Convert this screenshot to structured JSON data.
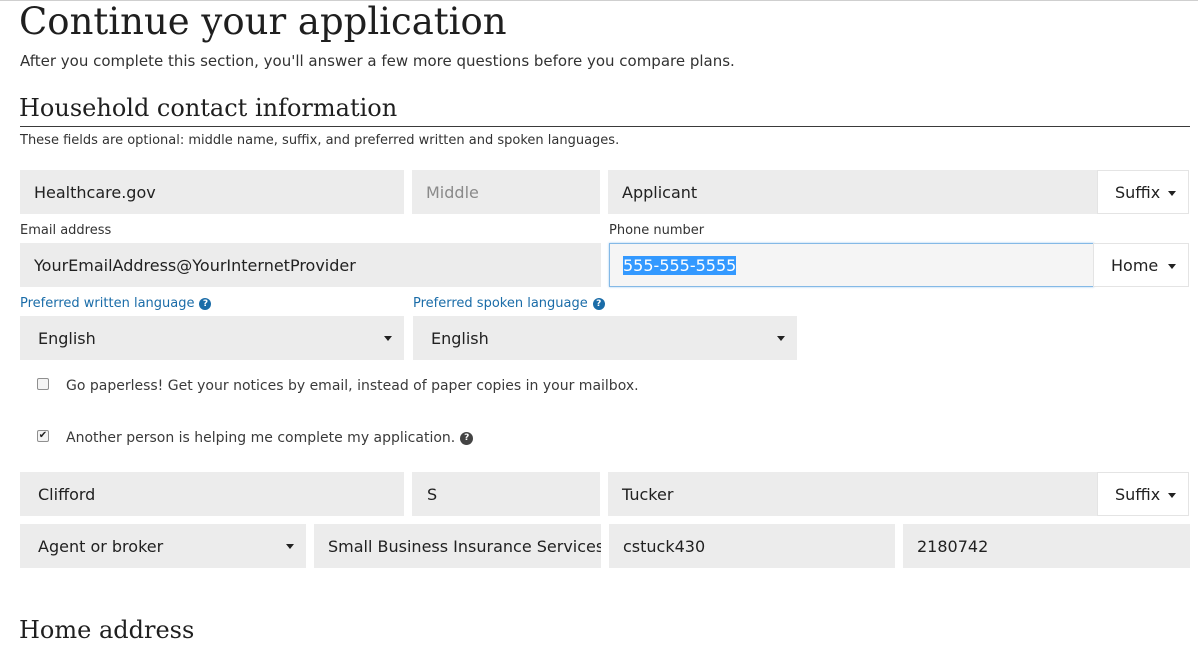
{
  "page": {
    "title": "Continue your application",
    "intro": "After you complete this section, you'll answer a few more questions before you compare plans."
  },
  "contact": {
    "heading": "Household contact information",
    "note": "These fields are optional: middle name, suffix, and preferred written and spoken languages.",
    "first_name": "Healthcare.gov",
    "middle_placeholder": "Middle",
    "last_name": "Applicant",
    "suffix": "Suffix",
    "email_label": "Email address",
    "email_value": "YourEmailAddress@YourInternetProvider",
    "phone_label": "Phone number",
    "phone_value": "555-555-5555",
    "phone_type": "Home",
    "written_language_label": "Preferred written language",
    "written_language_value": "English",
    "spoken_language_label": "Preferred spoken language",
    "spoken_language_value": "English",
    "help_glyph": "?"
  },
  "options": {
    "paperless_label": "Go paperless! Get your notices by email, instead of paper copies in your mailbox.",
    "paperless_checked": false,
    "helper_label": "Another person is helping me complete my application.",
    "helper_checked": true,
    "check_glyph": "✔"
  },
  "helper": {
    "first_name": "Clifford",
    "middle_name": "S",
    "last_name": "Tucker",
    "suffix": "Suffix",
    "role": "Agent or broker",
    "organization": "Small Business Insurance Services I",
    "user_id": "cstuck430",
    "npn": "2180742"
  },
  "next_section": {
    "heading": "Home address"
  }
}
